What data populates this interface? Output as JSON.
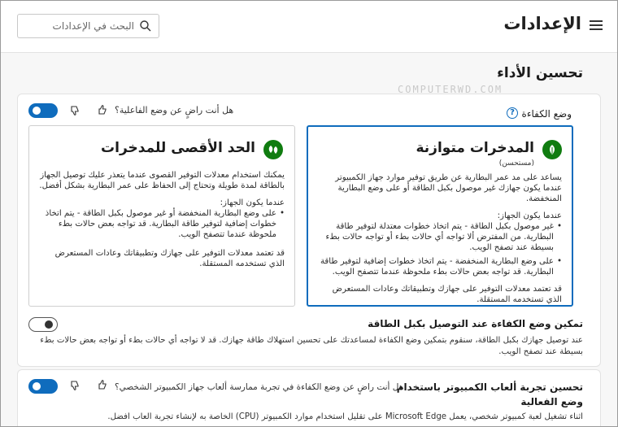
{
  "header": {
    "title": "الإعدادات",
    "search_placeholder": "البحث في الإعدادات"
  },
  "section": {
    "title": "تحسين الأداء",
    "watermark": "COMPUTERWD.COM"
  },
  "efficiency": {
    "feedback_question": "هل أنت راضٍ عن وضع الفاعلية؟",
    "toggle_on": true,
    "mode_label": "وضع الكفاءة",
    "help_symbol": "?"
  },
  "cards": {
    "balanced": {
      "title": "المدخرات متوازنة",
      "subtitle": "(مستحسن)",
      "description": "يساعد على مد عمر البطارية عن طريق توفير موارد جهاز الكمبيوتر عندما يكون جهازك غير موصول بكبل الطاقة أو على وضع البطارية المنخفضة.",
      "when_label": "عندما يكون الجهاز:",
      "bullets": [
        "غير موصول بكبل الطاقة - يتم اتخاذ خطوات معتدلة لتوفير طاقة البطارية. من المفترض ألا تواجه أي حالات بطء أو تواجه حالات بطء بسيطة عند تصفح الويب.",
        "على وضع البطارية المنخفضة - يتم اتخاذ خطوات إضافية لتوفير طاقة البطارية. قد تواجه بعض حالات بطء ملحوظة عندما تتصفح الويب."
      ],
      "footer": "قد تعتمد معدلات التوفير على جهازك وتطبيقاتك وعادات المستعرض الذي تستخدمه المستقلة."
    },
    "maximum": {
      "title": "الحد الأقصى للمدخرات",
      "description": "يمكنك استخدام معدلات التوفير القصوى عندما يتعذر عليك توصيل الجهاز بالطاقة لمدة طويلة وتحتاج إلى الحفاظ على عمر البطارية بشكل أفضل.",
      "when_label": "عندما يكون الجهاز:",
      "bullets": [
        "على وضع البطارية المنخفضة أو غير موصول بكبل الطاقة - يتم اتخاذ خطوات إضافية لتوفير طاقة البطارية. قد تواجه بعض حالات بطء ملحوظة عندما تتصفح الويب."
      ],
      "footer": "قد تعتمد معدلات التوفير على جهازك وتطبيقاتك وعادات المستعرض الذي تستخدمه المستقلة."
    }
  },
  "plugged": {
    "title": "تمكين وضع الكفاءة عند التوصيل بكبل الطاقة",
    "toggle_on": false,
    "description": "عند توصيل جهازك بكبل الطاقة، سنقوم بتمكين وضع الكفاءة لمساعدتك على تحسين استهلاك طاقة جهازك. قد لا تواجه أي حالات بطء أو تواجه بعض حالات بطء بسيطة عند تصفح الويب."
  },
  "gaming": {
    "title": "تحسين تجربة ألعاب الكمبيوتر باستخدام وضع الفعالية",
    "feedback_question": "هل أنت راضٍ عن وضع الكفاءة في تجربة ممارسة ألعاب جهاز الكمبيوتر الشخصي؟",
    "toggle_on": true,
    "description": "أثناء تشغيل لعبة كمبيوتر شخصي، يعمل Microsoft Edge على تقليل استخدام موارد الكمبيوتر (CPU) الخاصة به لإنشاء تجربة ألعاب أفضل."
  },
  "colors": {
    "accent": "#0f6cbd",
    "badge_green": "#107c10"
  }
}
